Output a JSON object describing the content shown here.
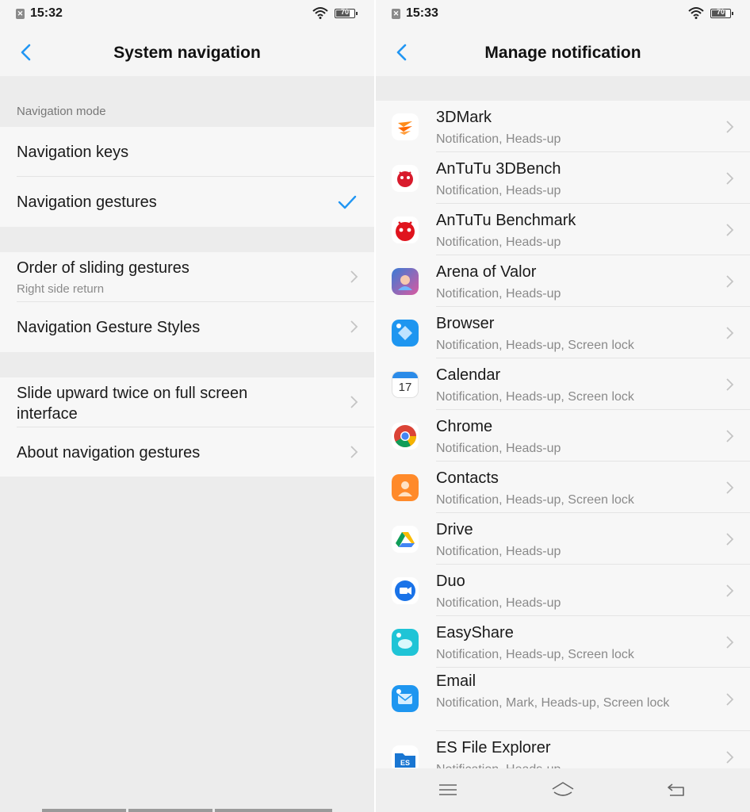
{
  "left": {
    "status": {
      "time": "15:32",
      "battery": "70"
    },
    "header": {
      "title": "System navigation"
    },
    "section_label": "Navigation mode",
    "mode_items": [
      {
        "label": "Navigation keys",
        "selected": false
      },
      {
        "label": "Navigation gestures",
        "selected": true
      }
    ],
    "gesture_items": [
      {
        "label": "Order of sliding gestures",
        "sub": "Right side return"
      },
      {
        "label": "Navigation Gesture Styles"
      }
    ],
    "more_items": [
      {
        "label": "Slide upward twice on full screen interface"
      },
      {
        "label": "About navigation gestures"
      }
    ]
  },
  "right": {
    "status": {
      "time": "15:33",
      "battery": "70"
    },
    "header": {
      "title": "Manage notification"
    },
    "apps": [
      {
        "name": "3DMark",
        "sub": "Notification, Heads-up",
        "icon": "3dmark-icon"
      },
      {
        "name": "AnTuTu 3DBench",
        "sub": "Notification, Heads-up",
        "icon": "antutu-3dbench-icon"
      },
      {
        "name": "AnTuTu Benchmark",
        "sub": "Notification, Heads-up",
        "icon": "antutu-benchmark-icon"
      },
      {
        "name": "Arena of Valor",
        "sub": "Notification, Heads-up",
        "icon": "arena-of-valor-icon"
      },
      {
        "name": "Browser",
        "sub": "Notification, Heads-up, Screen lock",
        "icon": "browser-icon"
      },
      {
        "name": "Calendar",
        "sub": "Notification, Heads-up, Screen lock",
        "icon": "calendar-icon",
        "icon_text": "17"
      },
      {
        "name": "Chrome",
        "sub": "Notification, Heads-up",
        "icon": "chrome-icon"
      },
      {
        "name": "Contacts",
        "sub": "Notification, Heads-up, Screen lock",
        "icon": "contacts-icon"
      },
      {
        "name": "Drive",
        "sub": "Notification, Heads-up",
        "icon": "drive-icon"
      },
      {
        "name": "Duo",
        "sub": "Notification, Heads-up",
        "icon": "duo-icon"
      },
      {
        "name": "EasyShare",
        "sub": "Notification, Heads-up, Screen lock",
        "icon": "easyshare-icon"
      },
      {
        "name": "Email",
        "sub": "Notification, Mark, Heads-up, Screen lock",
        "icon": "email-icon"
      },
      {
        "name": "ES File Explorer",
        "sub": "Notification, Heads-up",
        "icon": "es-file-explorer-icon"
      }
    ],
    "nav_buttons": [
      "menu-icon",
      "home-icon",
      "back-nav-icon"
    ]
  },
  "colors": {
    "accent": "#2196f3",
    "chevron": "#c4c4c4"
  }
}
